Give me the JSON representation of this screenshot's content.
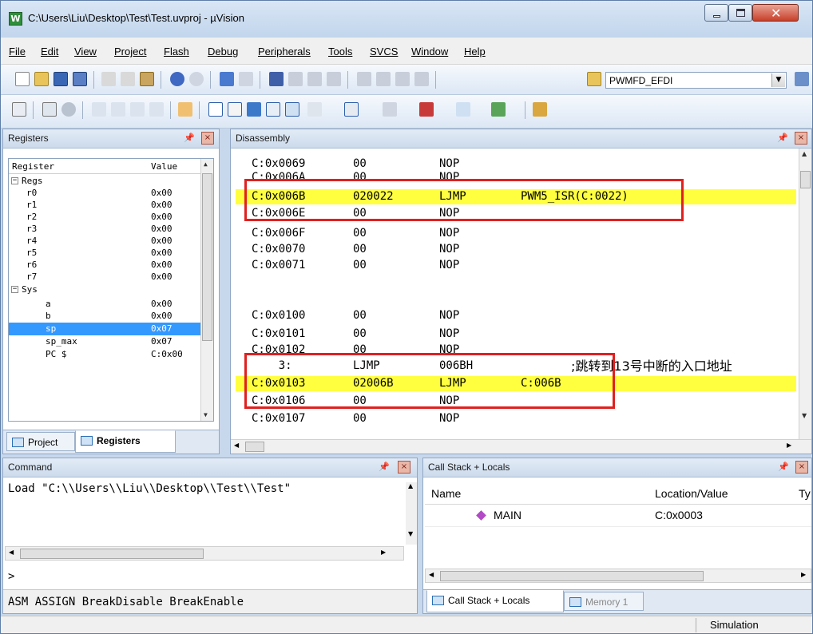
{
  "window": {
    "title": "C:\\Users\\Liu\\Desktop\\Test\\Test.uvproj - µVision",
    "app_icon": "W"
  },
  "menu": [
    "File",
    "Edit",
    "View",
    "Project",
    "Flash",
    "Debug",
    "Peripherals",
    "Tools",
    "SVCS",
    "Window",
    "Help"
  ],
  "toolbar": {
    "target": "PWMFD_EFDI"
  },
  "registers": {
    "panel_title": "Registers",
    "col_register": "Register",
    "col_value": "Value",
    "groups": {
      "regs": "Regs",
      "sys": "Sys"
    },
    "rows": [
      {
        "name": "r0",
        "value": "0x00"
      },
      {
        "name": "r1",
        "value": "0x00"
      },
      {
        "name": "r2",
        "value": "0x00"
      },
      {
        "name": "r3",
        "value": "0x00"
      },
      {
        "name": "r4",
        "value": "0x00"
      },
      {
        "name": "r5",
        "value": "0x00"
      },
      {
        "name": "r6",
        "value": "0x00"
      },
      {
        "name": "r7",
        "value": "0x00"
      },
      {
        "name": "a",
        "value": "0x00"
      },
      {
        "name": "b",
        "value": "0x00"
      },
      {
        "name": "sp",
        "value": "0x07"
      },
      {
        "name": "sp_max",
        "value": "0x07"
      },
      {
        "name": "PC  $",
        "value": "C:0x00"
      }
    ],
    "tabs": [
      "Project",
      "Registers"
    ]
  },
  "disassembly": {
    "panel_title": "Disassembly",
    "lines": [
      {
        "addr": "C:0x0069",
        "op": "00",
        "mn": "NOP",
        "arg": "",
        "comment": ""
      },
      {
        "addr": "C:0x006A",
        "op": "00",
        "mn": "NOP",
        "arg": "",
        "comment": ""
      },
      {
        "addr": "C:0x006B",
        "op": "020022",
        "mn": "LJMP",
        "arg": "PWM5_ISR(C:0022)",
        "comment": ""
      },
      {
        "addr": "C:0x006E",
        "op": "00",
        "mn": "NOP",
        "arg": "",
        "comment": ""
      },
      {
        "addr": "C:0x006F",
        "op": "00",
        "mn": "NOP",
        "arg": "",
        "comment": ""
      },
      {
        "addr": "C:0x0070",
        "op": "00",
        "mn": "NOP",
        "arg": "",
        "comment": ""
      },
      {
        "addr": "C:0x0071",
        "op": "00",
        "mn": "NOP",
        "arg": "",
        "comment": ""
      },
      {
        "addr": "C:0x0100",
        "op": "00",
        "mn": "NOP",
        "arg": "",
        "comment": ""
      },
      {
        "addr": "C:0x0101",
        "op": "00",
        "mn": "NOP",
        "arg": "",
        "comment": ""
      },
      {
        "addr": "C:0x0102",
        "op": "00",
        "mn": "NOP",
        "arg": "",
        "comment": ""
      },
      {
        "addr": "    3:",
        "op": "LJMP",
        "mn": "006BH",
        "arg": "",
        "comment": ";跳转到13号中断的入口地址"
      },
      {
        "addr": "C:0x0103",
        "op": "02006B",
        "mn": "LJMP",
        "arg": "C:006B",
        "comment": ""
      },
      {
        "addr": "C:0x0106",
        "op": "00",
        "mn": "NOP",
        "arg": "",
        "comment": ""
      },
      {
        "addr": "C:0x0107",
        "op": "00",
        "mn": "NOP",
        "arg": "",
        "comment": ""
      }
    ]
  },
  "command": {
    "panel_title": "Command",
    "output": "Load \"C:\\\\Users\\\\Liu\\\\Desktop\\\\Test\\\\Test\"",
    "prompt": ">",
    "hint": "ASM ASSIGN BreakDisable BreakEnable"
  },
  "callstack": {
    "panel_title": "Call Stack + Locals",
    "col_name": "Name",
    "col_location": "Location/Value",
    "col_type": "Ty",
    "rows": [
      {
        "name": "MAIN",
        "location": "C:0x0003"
      }
    ],
    "tabs": [
      "Call Stack + Locals",
      "Memory 1"
    ]
  },
  "status": {
    "mode": "Simulation"
  },
  "colors": {
    "highlight": "#ffff40",
    "annotation_box": "#e02020",
    "selection": "#3399ff"
  }
}
